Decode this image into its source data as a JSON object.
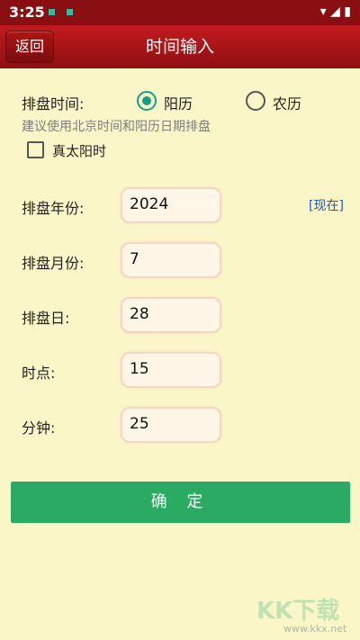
{
  "status_bar": {
    "time": "3:25"
  },
  "header": {
    "back_label": "返回",
    "title": "时间输入"
  },
  "form": {
    "time_label": "排盘时间:",
    "calendar_options": [
      {
        "label": "阳历",
        "selected": true
      },
      {
        "label": "农历",
        "selected": false
      }
    ],
    "hint": "建议使用北京时间和阳历日期排盘",
    "true_solar_time": {
      "label": "真太阳时",
      "checked": false
    },
    "fields": {
      "year": {
        "label": "排盘年份:",
        "value": "2024"
      },
      "month": {
        "label": "排盘月份:",
        "value": "7"
      },
      "day": {
        "label": "排盘日:",
        "value": "28"
      },
      "hour": {
        "label": "时点:",
        "value": "15"
      },
      "minute": {
        "label": "分钟:",
        "value": "25"
      }
    },
    "now_link": "[现在]"
  },
  "actions": {
    "confirm_label": "确 定"
  },
  "watermark": {
    "logo": "KK下载",
    "url": "www.kkx.net"
  },
  "colors": {
    "header": "#b01416",
    "accent": "#159e8c",
    "confirm": "#2aaa63",
    "background": "#fbf6c8"
  }
}
